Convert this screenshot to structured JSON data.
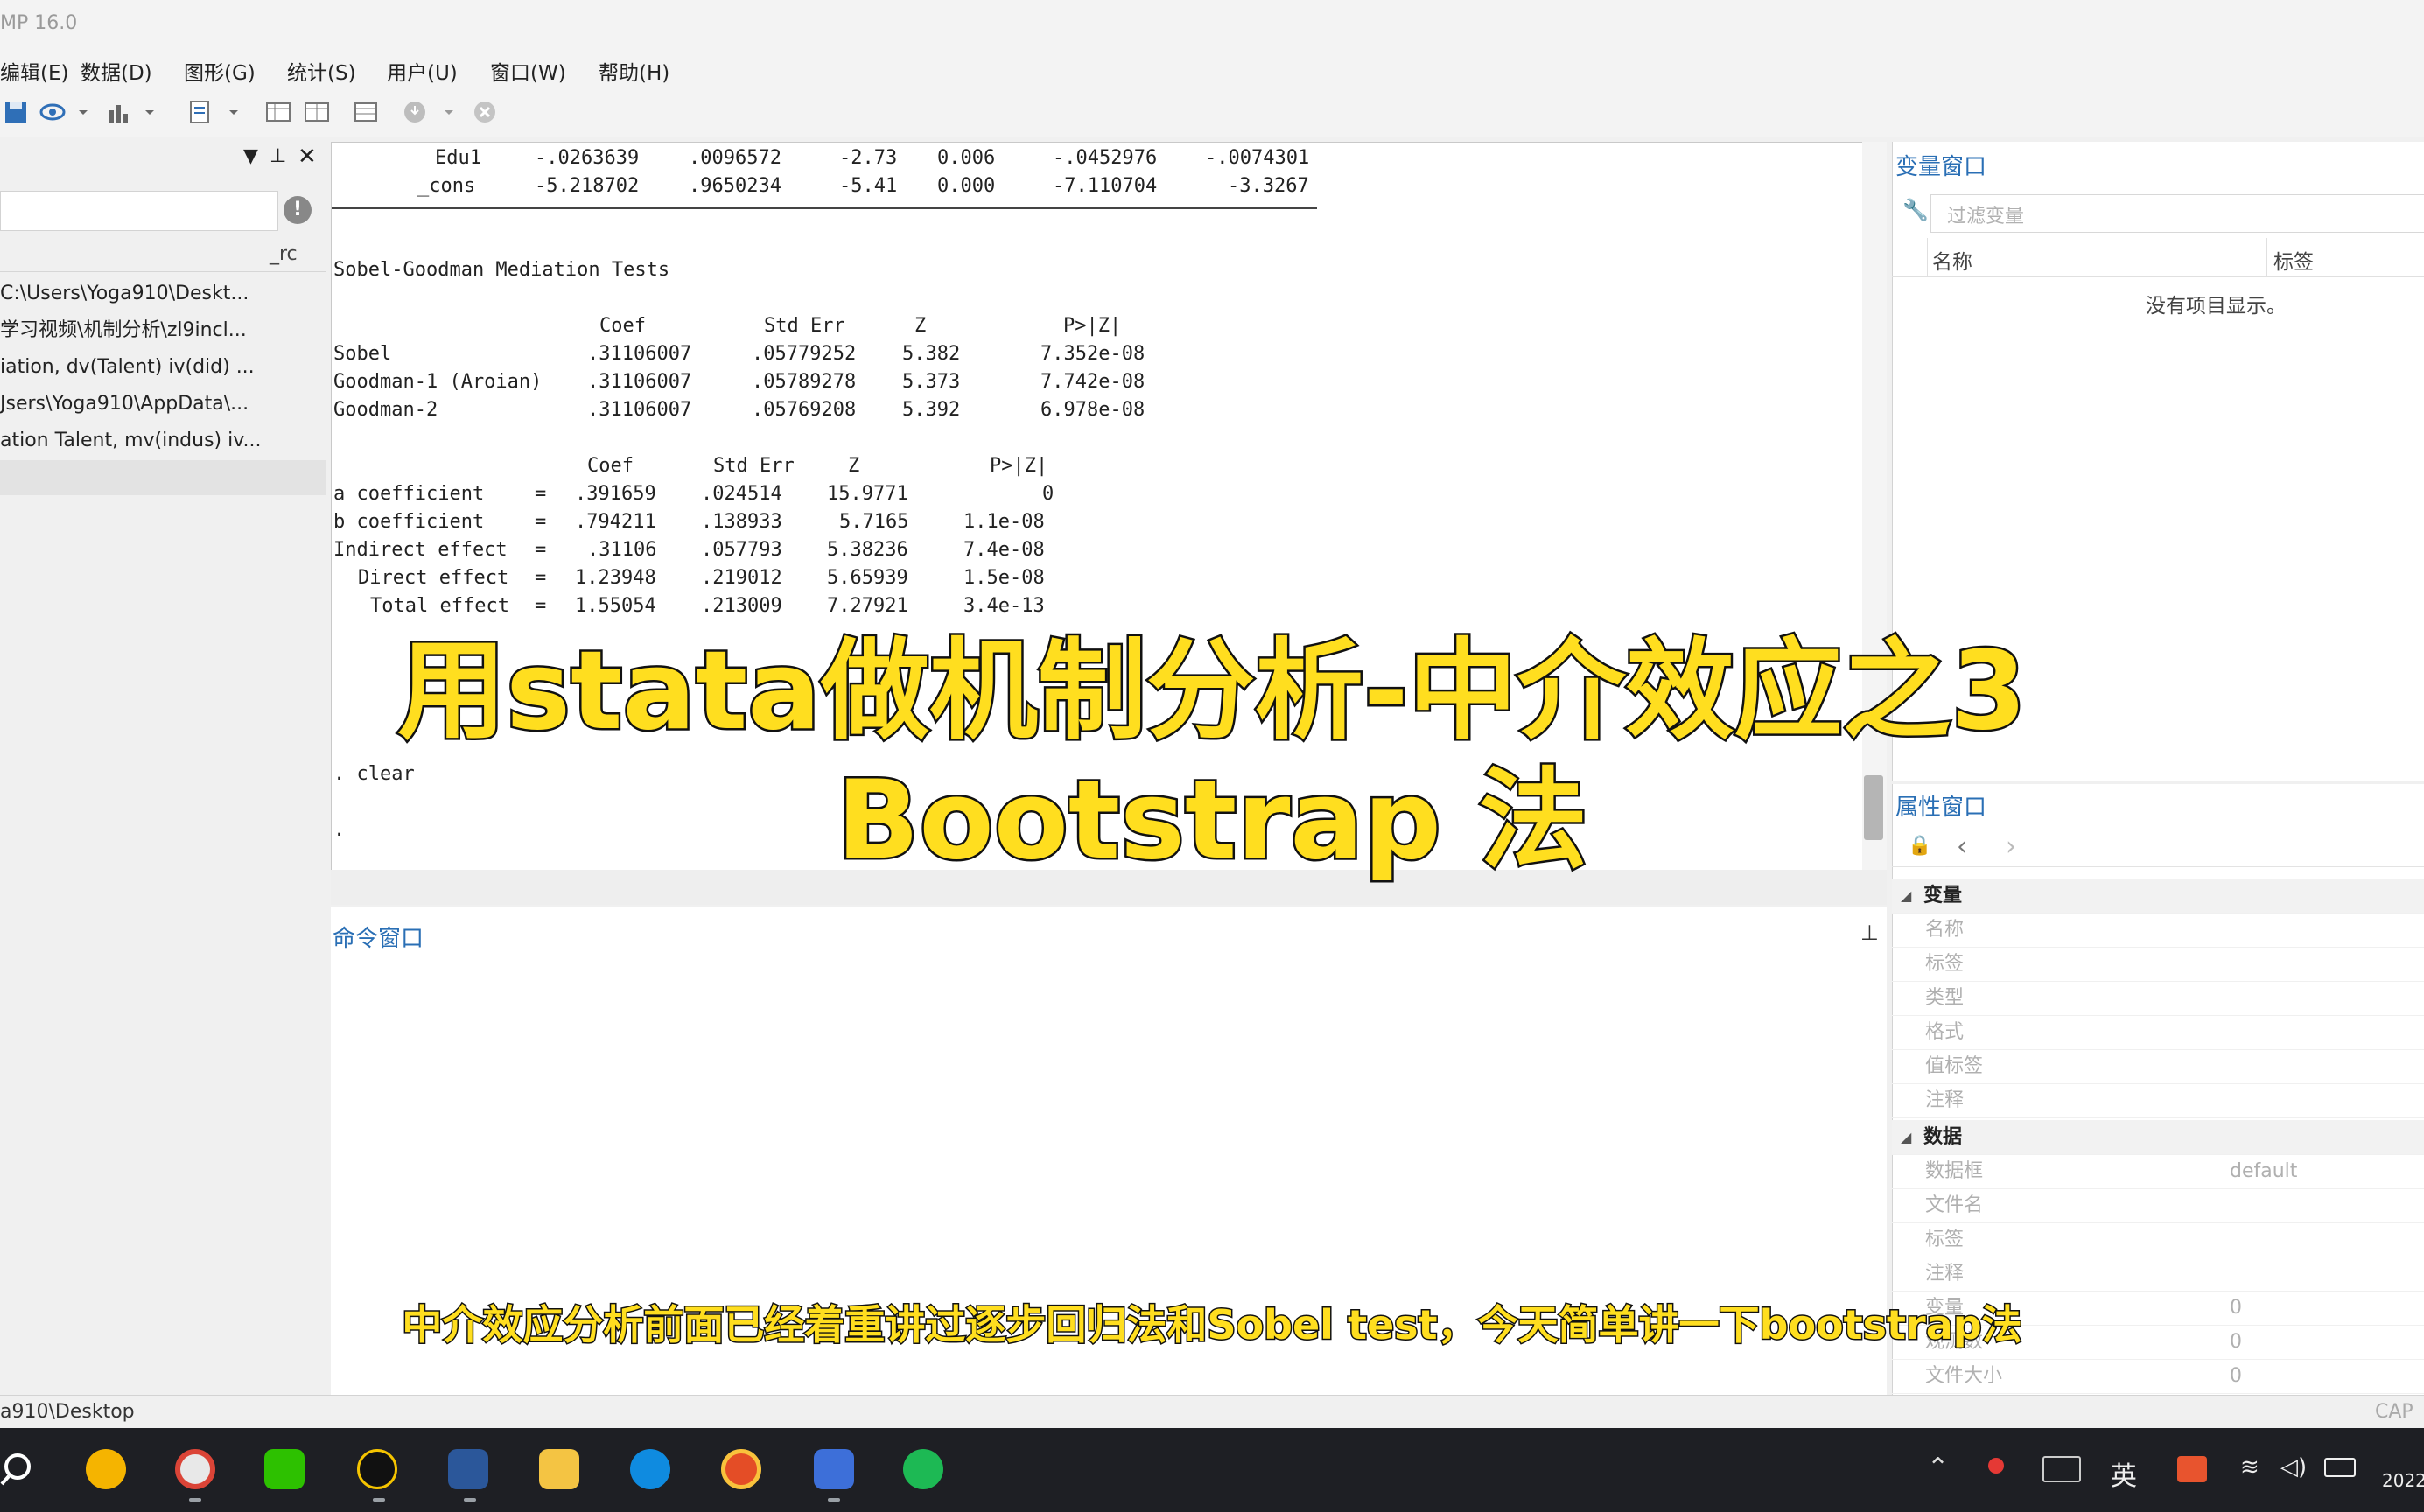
{
  "window": {
    "title": "MP 16.0"
  },
  "menu": [
    "编辑(E)",
    "数据(D)",
    "图形(G)",
    "统计(S)",
    "用户(U)",
    "窗口(W)",
    "帮助(H)"
  ],
  "left_panel": {
    "column_label": "_rc",
    "history": [
      "C:\\Users\\Yoga910\\Deskt...",
      "学习视频\\机制分析\\zl9incl...",
      "iation, dv(Talent) iv(did) ...",
      "Jsers\\Yoga910\\AppData\\...",
      "ation Talent, mv(indus) iv..."
    ]
  },
  "results": {
    "reg_rows": [
      {
        "var": "Edu1",
        "coef": "-.0263639",
        "se": ".0096572",
        "t": "-2.73",
        "p": "0.006",
        "lo": "-.0452976",
        "hi": "-.0074301"
      },
      {
        "var": "_cons",
        "coef": "-5.218702",
        "se": ".9650234",
        "t": "-5.41",
        "p": "0.000",
        "lo": "-7.110704",
        "hi": "-3.3267"
      }
    ],
    "sobel_title": "Sobel-Goodman Mediation Tests",
    "sobel_header": {
      "coef": "Coef",
      "se": "Std Err",
      "z": "Z",
      "p": "P>|Z|"
    },
    "sobel_rows": [
      {
        "name": "Sobel",
        "coef": ".31106007",
        "se": ".05779252",
        "z": "5.382",
        "p": "7.352e-08"
      },
      {
        "name": "Goodman-1 (Aroian)",
        "coef": ".31106007",
        "se": ".05789278",
        "z": "5.373",
        "p": "7.742e-08"
      },
      {
        "name": "Goodman-2",
        "coef": ".31106007",
        "se": ".05769208",
        "z": "5.392",
        "p": "6.978e-08"
      }
    ],
    "effect_header": {
      "coef": "Coef",
      "se": "Std Err",
      "z": "Z",
      "p": "P>|Z|"
    },
    "effect_rows": [
      {
        "name": "a coefficient",
        "coef": ".391659",
        "se": ".024514",
        "z": "15.9771",
        "p": "0"
      },
      {
        "name": "b coefficient",
        "coef": ".794211",
        "se": ".138933",
        "z": "5.7165",
        "p": "1.1e-08"
      },
      {
        "name": "Indirect effect",
        "coef": ".31106",
        "se": ".057793",
        "z": "5.38236",
        "p": "7.4e-08"
      },
      {
        "name": "Direct effect",
        "coef": "1.23948",
        "se": ".219012",
        "z": "5.65939",
        "p": "1.5e-08"
      },
      {
        "name": "Total effect",
        "coef": "1.55054",
        "se": ".213009",
        "z": "7.27921",
        "p": "3.4e-13"
      }
    ],
    "command_echo": ". clear",
    "prompt": "."
  },
  "command_window": {
    "title": "命令窗口"
  },
  "variables_window": {
    "title": "变量窗口",
    "filter_placeholder": "过滤变量",
    "col_name": "名称",
    "col_label": "标签",
    "empty_text": "没有项目显示。"
  },
  "properties_window": {
    "title": "属性窗口",
    "sections": [
      {
        "name": "变量",
        "rows": [
          {
            "key": "名称",
            "value": ""
          },
          {
            "key": "标签",
            "value": ""
          },
          {
            "key": "类型",
            "value": ""
          },
          {
            "key": "格式",
            "value": ""
          },
          {
            "key": "值标签",
            "value": ""
          },
          {
            "key": "注释",
            "value": ""
          }
        ]
      },
      {
        "name": "数据",
        "rows": [
          {
            "key": "数据框",
            "value": "default"
          },
          {
            "key": "文件名",
            "value": ""
          },
          {
            "key": "标签",
            "value": ""
          },
          {
            "key": "注释",
            "value": ""
          },
          {
            "key": "变量",
            "value": "0"
          },
          {
            "key": "观测数",
            "value": "0"
          },
          {
            "key": "文件大小",
            "value": "0"
          }
        ]
      }
    ]
  },
  "status_bar": {
    "path": "a910\\Desktop",
    "caps": "CAP"
  },
  "taskbar": {
    "ime": "英",
    "clock": "2022"
  },
  "overlay": {
    "headline_line1": "用stata做机制分析-中介效应之3",
    "headline_line2": "Bootstrap 法",
    "subtitle": "中介效应分析前面已经着重讲过逐步回归法和Sobel test，今天简单讲一下bootstrap法"
  }
}
